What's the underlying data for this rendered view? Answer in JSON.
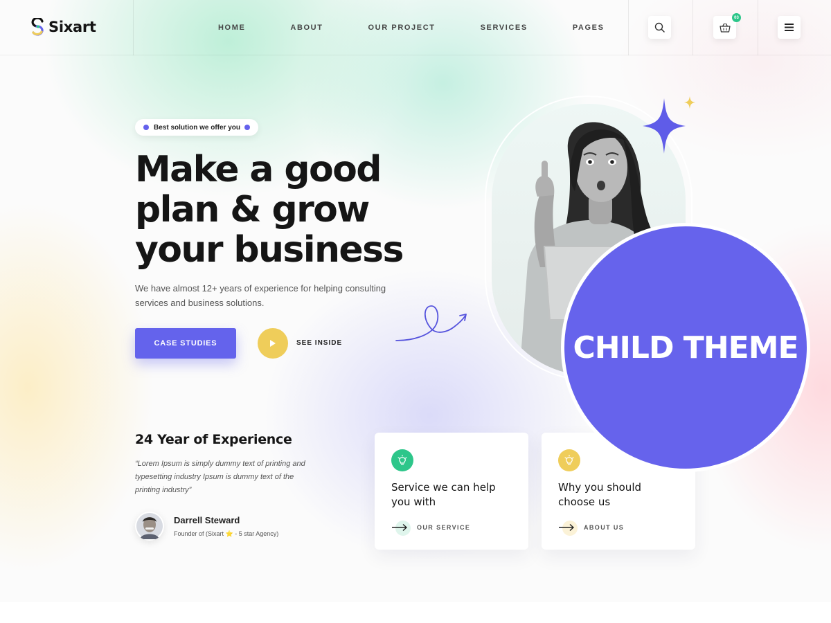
{
  "header": {
    "logo_text": "Sixart",
    "nav": [
      "HOME",
      "ABOUT",
      "OUR PROJECT",
      "SERVICES",
      "PAGES"
    ],
    "cart_count": "03",
    "icons": [
      "search-icon",
      "cart-icon",
      "menu-icon"
    ]
  },
  "hero": {
    "badge": "Best solution we offer you",
    "title_lines": [
      "Make a good",
      "plan & grow",
      "your business"
    ],
    "description": "We have almost 12+ years of experience for helping consulting services and business solutions.",
    "primary_button": "CASE STUDIES",
    "secondary_button": "SEE INSIDE"
  },
  "overlay_badge": "CHILD THEME",
  "experience": {
    "title": "24 Year of Experience",
    "quote": "“Lorem Ipsum is simply dummy text of printing and typesetting industry Ipsum is dummy text of the printing industry”",
    "person_name": "Darrell Steward",
    "person_role": "Founder of (Sixart ⭐ - 5 star Agency)"
  },
  "cards": [
    {
      "title": "Service we can help you with",
      "link": "OUR SERVICE",
      "icon_color": "#2dc68a"
    },
    {
      "title": "Why you should choose us",
      "link": "ABOUT US",
      "icon_color": "#efcd5a"
    }
  ],
  "colors": {
    "accent": "#6463ec",
    "yellow": "#efcd5a",
    "green": "#2dc68a"
  }
}
